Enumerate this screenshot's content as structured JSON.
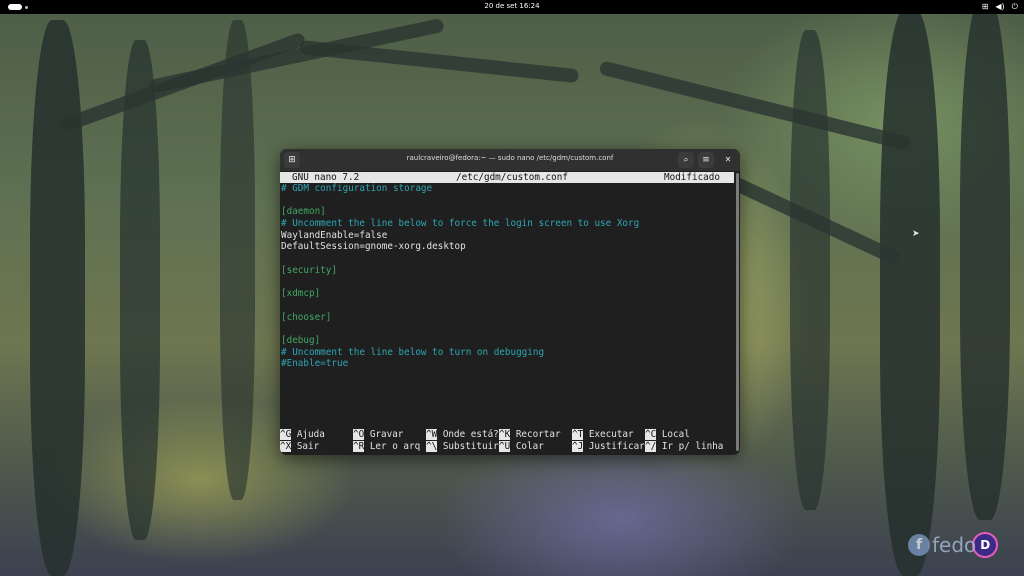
{
  "topbar": {
    "clock": "20 de set  16:24",
    "icons": [
      "network-icon",
      "volume-icon",
      "power-icon"
    ]
  },
  "window": {
    "title": "raulcraveiro@fedora:~ — sudo nano /etc/gdm/custom.conf",
    "buttons": [
      "new-tab-icon",
      "search-icon",
      "menu-icon",
      "close-icon"
    ]
  },
  "nano": {
    "version": "GNU nano 7.2",
    "filename": "/etc/gdm/custom.conf",
    "status": "Modificado",
    "lines": [
      {
        "text": "# GDM configuration storage",
        "type": "comment"
      },
      {
        "text": "",
        "type": "plain"
      },
      {
        "text": "[daemon]",
        "type": "section"
      },
      {
        "text": "# Uncomment the line below to force the login screen to use Xorg",
        "type": "comment"
      },
      {
        "text": "WaylandEnable=false",
        "type": "plain"
      },
      {
        "text": "DefaultSession=gnome-xorg.desktop",
        "type": "plain"
      },
      {
        "text": "",
        "type": "plain"
      },
      {
        "text": "[security]",
        "type": "section"
      },
      {
        "text": "",
        "type": "plain"
      },
      {
        "text": "[xdmcp]",
        "type": "section"
      },
      {
        "text": "",
        "type": "plain"
      },
      {
        "text": "[chooser]",
        "type": "section"
      },
      {
        "text": "",
        "type": "plain"
      },
      {
        "text": "[debug]",
        "type": "section"
      },
      {
        "text": "# Uncomment the line below to turn on debugging",
        "type": "comment"
      },
      {
        "text": "#Enable=true",
        "type": "comment"
      }
    ],
    "shortcuts": [
      [
        {
          "key": "^G",
          "label": "Ajuda"
        },
        {
          "key": "^O",
          "label": "Gravar"
        },
        {
          "key": "^W",
          "label": "Onde está?"
        },
        {
          "key": "^K",
          "label": "Recortar"
        },
        {
          "key": "^T",
          "label": "Executar"
        },
        {
          "key": "^C",
          "label": "Local"
        }
      ],
      [
        {
          "key": "^X",
          "label": "Sair"
        },
        {
          "key": "^R",
          "label": "Ler o arq"
        },
        {
          "key": "^\\",
          "label": "Substituir"
        },
        {
          "key": "^U",
          "label": "Colar"
        },
        {
          "key": "^J",
          "label": "Justificar"
        },
        {
          "key": "^/",
          "label": "Ir p/ linha"
        }
      ]
    ]
  },
  "logo": {
    "text": "fedo",
    "badge": "D"
  }
}
